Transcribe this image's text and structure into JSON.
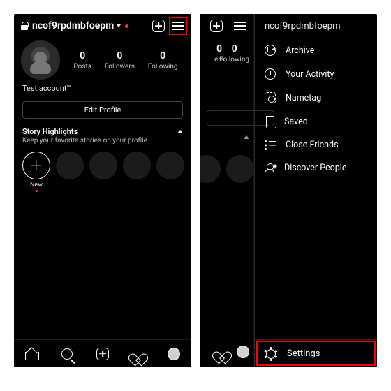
{
  "left": {
    "username": "ncof9rpdmbfoepm",
    "display_name": "Test account™",
    "stats": {
      "posts": {
        "value": "0",
        "label": "Posts"
      },
      "followers": {
        "value": "0",
        "label": "Followers"
      },
      "following": {
        "value": "0",
        "label": "Following"
      }
    },
    "edit_profile": "Edit Profile",
    "highlights": {
      "title": "Story Highlights",
      "subtitle": "Keep your favorite stories on your profile",
      "new_label": "New"
    }
  },
  "right": {
    "username": "ncof9rpdmbfoepm",
    "partial_stats": {
      "followers": {
        "value": "0",
        "label": "ers"
      },
      "following": {
        "value": "0",
        "label": "Following"
      }
    },
    "menu": {
      "archive": "Archive",
      "activity": "Your Activity",
      "nametag": "Nametag",
      "saved": "Saved",
      "close_friends": "Close Friends",
      "discover": "Discover People"
    },
    "settings": "Settings"
  }
}
